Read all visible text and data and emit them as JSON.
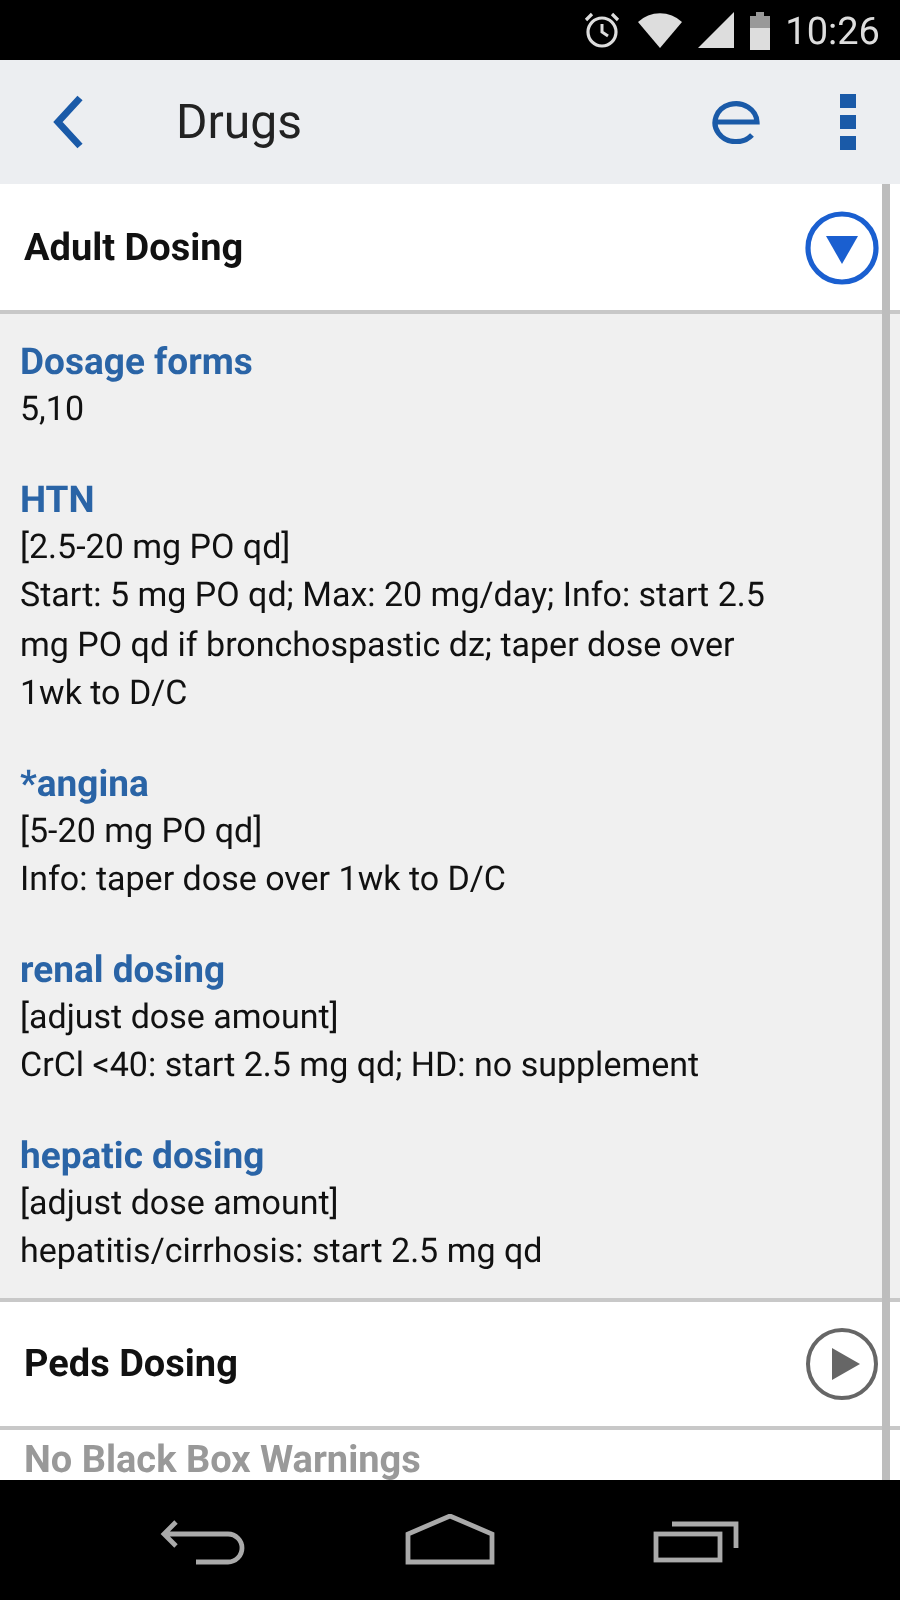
{
  "status_bar": {
    "time": "10:26"
  },
  "toolbar": {
    "title": "Drugs"
  },
  "sections": [
    {
      "title": "Adult Dosing",
      "expanded": true,
      "disabled": false,
      "entries": [
        {
          "heading": "Dosage forms",
          "lines": [
            "5,10"
          ]
        },
        {
          "heading": "HTN",
          "lines": [
            "[2.5-20 mg PO qd]",
            "Start: 5 mg PO qd; Max: 20 mg/day; Info: start 2.5 mg PO qd if bronchospastic dz; taper dose over 1wk to D/C"
          ]
        },
        {
          "heading": "*angina",
          "lines": [
            "[5-20 mg PO qd]",
            "Info: taper dose over 1wk to D/C"
          ]
        },
        {
          "heading": "renal dosing",
          "lines": [
            "[adjust dose amount]",
            "CrCl <40: start 2.5 mg qd; HD: no supplement"
          ]
        },
        {
          "heading": "hepatic dosing",
          "lines": [
            "[adjust dose amount]",
            "hepatitis/cirrhosis: start 2.5 mg qd"
          ]
        }
      ]
    },
    {
      "title": "Peds Dosing",
      "expanded": false,
      "disabled": false
    },
    {
      "title": "No Black Box Warnings",
      "expanded": false,
      "disabled": true
    }
  ]
}
